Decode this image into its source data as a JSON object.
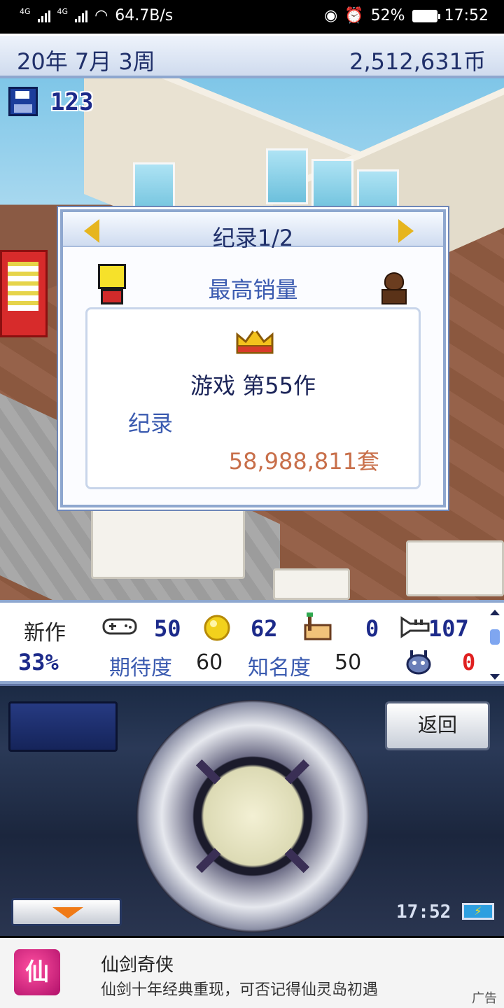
{
  "status_bar": {
    "network1": "4G",
    "network2": "4G",
    "speed": "64.7B/s",
    "battery": "52%",
    "time": "17:52"
  },
  "header": {
    "date": "20年 7月 3周",
    "money": "2,512,631币"
  },
  "scene": {
    "save_count": "123"
  },
  "dialog": {
    "title": "纪录1/2",
    "subtitle": "最高销量",
    "game_title": "游戏 第55作",
    "record_label": "纪录",
    "record_value": "58,988,811套"
  },
  "stats": {
    "new_label": "新作",
    "percent": "33%",
    "fun": "50",
    "creativity": "62",
    "graphics": "0",
    "sound": "107",
    "expectation_label": "期待度",
    "expectation_value": "60",
    "fame_label": "知名度",
    "fame_value": "50",
    "bugs": "0"
  },
  "controller": {
    "back_label": "返回",
    "clock": "17:52"
  },
  "ad": {
    "logo_text": "仙",
    "title": "仙剑奇侠",
    "description": "仙剑十年经典重现，可否记得仙灵岛初遇",
    "tag": "广告"
  }
}
